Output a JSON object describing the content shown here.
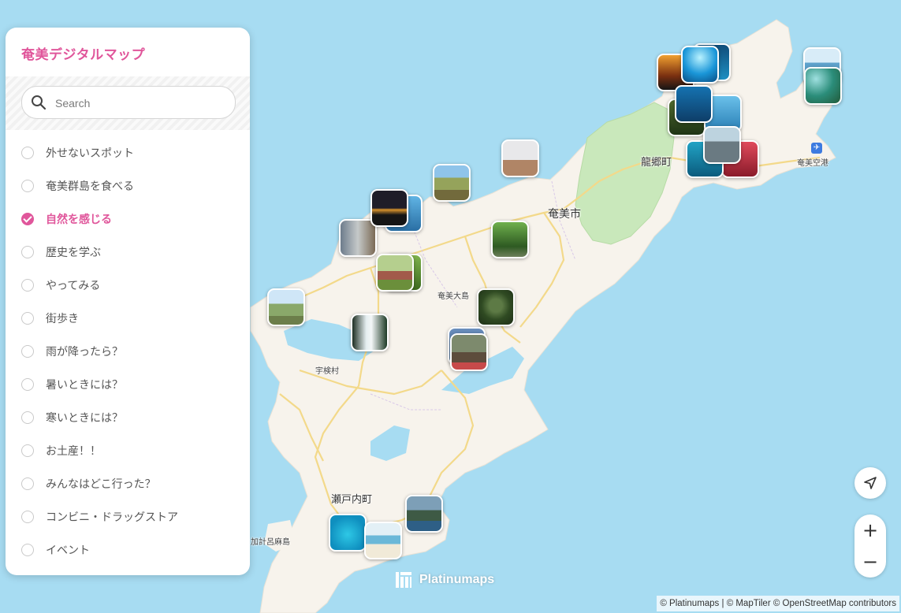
{
  "app": {
    "title": "奄美デジタルマップ"
  },
  "search": {
    "placeholder": "Search",
    "value": ""
  },
  "categories": [
    {
      "label": "外せないスポット",
      "checked": false
    },
    {
      "label": "奄美群島を食べる",
      "checked": false
    },
    {
      "label": "自然を感じる",
      "checked": true
    },
    {
      "label": "歴史を学ぶ",
      "checked": false
    },
    {
      "label": "やってみる",
      "checked": false
    },
    {
      "label": "街歩き",
      "checked": false
    },
    {
      "label": "雨が降ったら？",
      "checked": false
    },
    {
      "label": "暑いときには？",
      "checked": false
    },
    {
      "label": "寒いときには？",
      "checked": false
    },
    {
      "label": "お土産！！",
      "checked": false
    },
    {
      "label": "みんなはどこ行った？",
      "checked": false
    },
    {
      "label": "コンビニ・ドラッグストア",
      "checked": false
    },
    {
      "label": "イベント",
      "checked": false
    }
  ],
  "map": {
    "places": {
      "amami_city": "奄美市",
      "tatsugo": "龍郷町",
      "amami_airport": "奄美空港",
      "amami_oshima": "奄美大島",
      "uken": "宇検村",
      "setouchi": "瀬戸内町",
      "kakeroma": "加計呂麻島"
    },
    "colors": {
      "sea": "#a7dcf2",
      "land": "#f7f3ec",
      "forest": "#c9e8bb",
      "road": "#f3d98a",
      "accent": "#e0569b"
    }
  },
  "controls": {
    "locate_icon": "navigation-arrow-icon",
    "zoom_in": "+",
    "zoom_out": "−"
  },
  "brand": {
    "name": "Platinumaps"
  },
  "attribution": "© Platinumaps | © MapTiler © OpenStreetMap contributors"
}
